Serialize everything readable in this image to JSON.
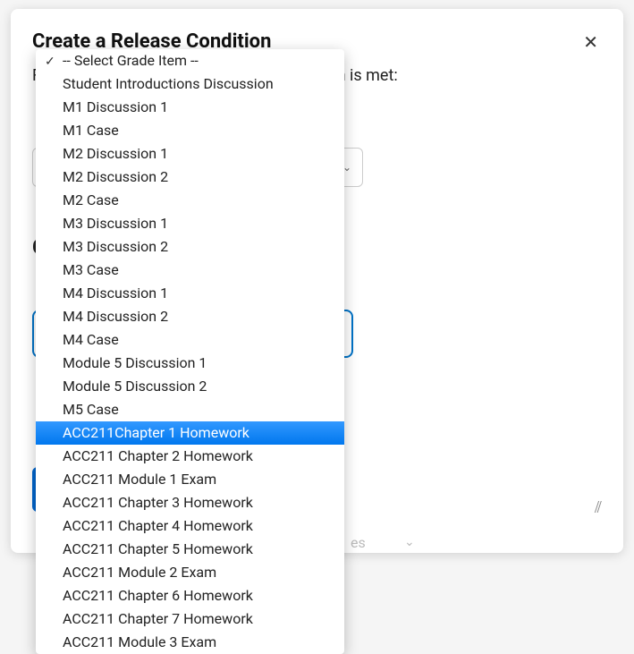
{
  "modal": {
    "title": "Create a Release Condition",
    "subtitle_visible_right": "dition is met:",
    "subtitle_visible_left": "R",
    "big_letter": "C",
    "footer_ghost": "es"
  },
  "dropdown": {
    "placeholder_item": "-- Select Grade Item --",
    "items": [
      "Student Introductions Discussion",
      "M1 Discussion 1",
      "M1 Case",
      "M2 Discussion 1",
      "M2 Discussion 2",
      "M2 Case",
      "M3 Discussion 1",
      "M3 Discussion 2",
      "M3 Case",
      "M4 Discussion 1",
      "M4 Discussion 2",
      "M4 Case",
      "Module 5 Discussion 1",
      "Module 5 Discussion 2",
      "M5 Case",
      "ACC211Chapter 1 Homework",
      "ACC211 Chapter 2 Homework",
      "ACC211 Module 1 Exam",
      "ACC211 Chapter 3 Homework",
      "ACC211 Chapter 4 Homework",
      "ACC211 Chapter 5 Homework",
      "ACC211 Module 2 Exam",
      "ACC211 Chapter 6 Homework",
      "ACC211 Chapter 7 Homework",
      "ACC211 Module 3 Exam"
    ],
    "selected_index": 15
  }
}
